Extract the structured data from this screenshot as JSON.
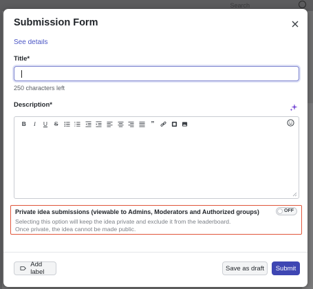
{
  "background": {
    "search_label": "Search"
  },
  "modal": {
    "title": "Submission Form",
    "see_details": "See details",
    "title_field": {
      "label": "Title",
      "required_mark": "*",
      "value": "",
      "chars_left": "250 characters left"
    },
    "description_field": {
      "label": "Description",
      "required_mark": "*"
    },
    "toolbar": [
      {
        "name": "bold-button",
        "glyph": "B"
      },
      {
        "name": "italic-button",
        "glyph": "I"
      },
      {
        "name": "underline-button",
        "glyph": "U"
      },
      {
        "name": "strikethrough-button",
        "glyph": "S"
      },
      {
        "name": "bullet-list-button",
        "glyph": "bullets"
      },
      {
        "name": "numbered-list-button",
        "glyph": "numbers"
      },
      {
        "name": "outdent-button",
        "glyph": "outdent"
      },
      {
        "name": "indent-button",
        "glyph": "indent"
      },
      {
        "name": "align-left-button",
        "glyph": "left"
      },
      {
        "name": "align-center-button",
        "glyph": "center"
      },
      {
        "name": "align-right-button",
        "glyph": "right"
      },
      {
        "name": "justify-button",
        "glyph": "justify"
      },
      {
        "name": "quote-button",
        "glyph": "quote"
      },
      {
        "name": "link-button",
        "glyph": "link"
      },
      {
        "name": "video-button",
        "glyph": "video"
      },
      {
        "name": "image-button",
        "glyph": "image"
      }
    ],
    "private": {
      "title": "Private idea submissions (viewable to Admins, Moderators and Authorized groups)",
      "desc_line1": "Selecting this option will keep the idea private and exclude it from the leaderboard.",
      "desc_line2": "Once private, the idea cannot be made public.",
      "toggle_state": "OFF"
    },
    "footer": {
      "add_label": "Add label",
      "save_draft": "Save as draft",
      "submit": "Submit"
    }
  },
  "colors": {
    "accent": "#3e46b3",
    "link": "#4a55c5",
    "highlight_border": "#e0553a",
    "sparkle": "#7b4fd6"
  }
}
